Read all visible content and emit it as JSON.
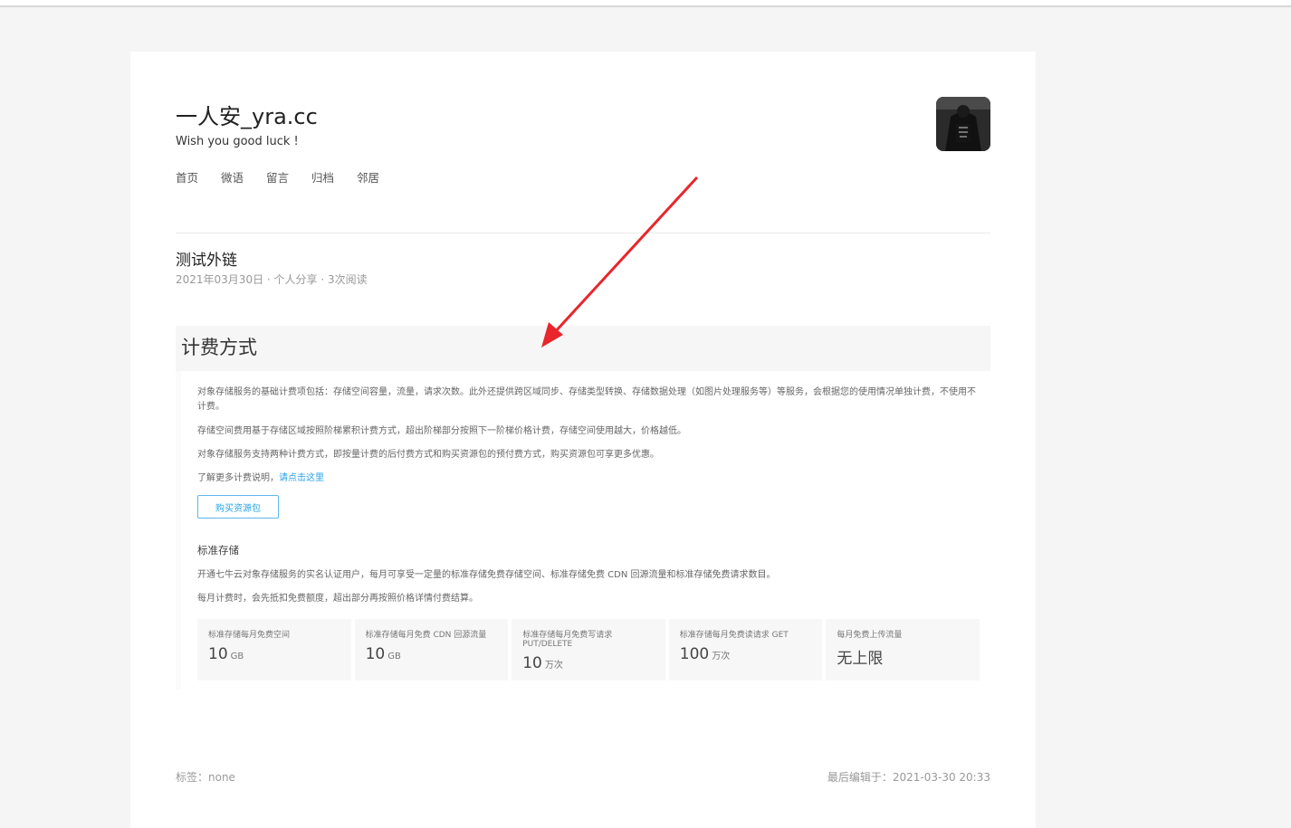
{
  "site": {
    "title": "一人安_yra.cc",
    "description": "Wish you good luck !",
    "nav": [
      "首页",
      "微语",
      "留言",
      "归档",
      "邻居"
    ]
  },
  "post": {
    "title": "测试外链",
    "meta": "2021年03月30日 · 个人分享 · 3次阅读"
  },
  "embedded_screenshot": {
    "heading": "计费方式",
    "paragraphs": [
      "对象存储服务的基础计费项包括：存储空间容量，流量，请求次数。此外还提供跨区域同步、存储类型转换、存储数据处理（如图片处理服务等）等服务，会根据您的使用情况单独计费，不使用不计费。",
      "存储空间费用基于存储区域按照阶梯累积计费方式，超出阶梯部分按照下一阶梯价格计费，存储空间使用越大，价格越低。",
      "对象存储服务支持两种计费方式，即按量计费的后付费方式和购买资源包的预付费方式，购买资源包可享更多优惠。"
    ],
    "more_info": "了解更多计费说明，",
    "more_link": "请点击这里",
    "buy_button": "购买资源包",
    "section_title": "标准存储",
    "section_paragraphs": [
      "开通七牛云对象存储服务的实名认证用户，每月可享受一定量的标准存储免费存储空间、标准存储免费 CDN 回源流量和标准存储免费请求数目。",
      "每月计费时，会先抵扣免费额度，超出部分再按照价格详情付费结算。"
    ],
    "stats": [
      {
        "label": "标准存储每月免费空间",
        "value": "10",
        "unit": "GB"
      },
      {
        "label": "标准存储每月免费 CDN 回源流量",
        "value": "10",
        "unit": "GB"
      },
      {
        "label": "标准存储每月免费写请求 PUT/DELETE",
        "value": "10",
        "unit": "万次"
      },
      {
        "label": "标准存储每月免费读请求 GET",
        "value": "100",
        "unit": "万次"
      },
      {
        "label": "每月免费上传流量",
        "value": "无上限",
        "unit": ""
      }
    ]
  },
  "footer": {
    "tags": "标签：none",
    "last_edited": "最后编辑于：2021-03-30 20:33"
  },
  "colors": {
    "accent": "#2aa3e6",
    "annotation_arrow": "#e8262b"
  },
  "icons": {
    "avatar": "avatar-image",
    "annotation": "red-arrow-icon"
  }
}
